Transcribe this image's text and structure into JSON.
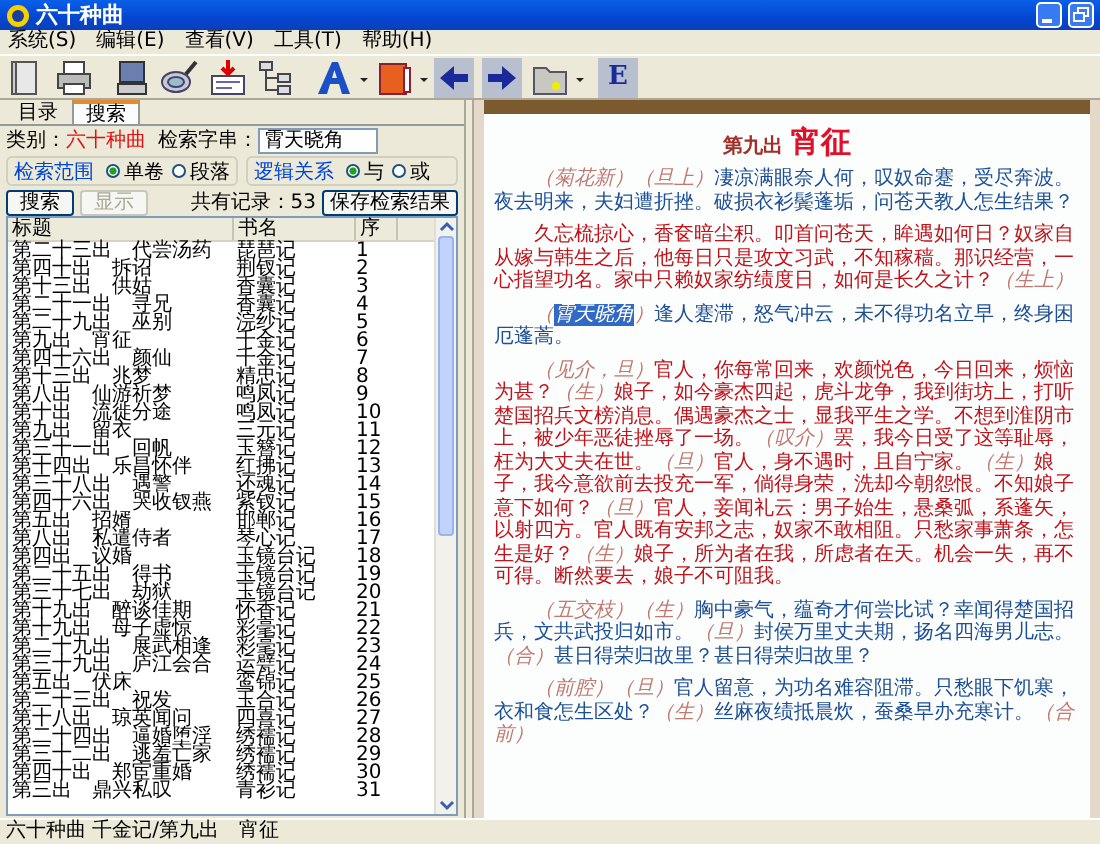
{
  "window": {
    "title": "六十种曲"
  },
  "menu": [
    "系统(S)",
    "编辑(E)",
    "查看(V)",
    "工具(T)",
    "帮助(H)"
  ],
  "toolbar": {
    "text_button": "E"
  },
  "tabs": [
    {
      "label": "目录",
      "selected": false
    },
    {
      "label": "搜索",
      "selected": true
    }
  ],
  "search": {
    "category_label": "类别：",
    "category_value": "六十种曲",
    "query_label": "检索字串：",
    "query": "霄天晓角",
    "groups": [
      {
        "label": "检索范围",
        "options": [
          {
            "label": "单卷",
            "selected": true
          },
          {
            "label": "段落",
            "selected": false
          }
        ]
      },
      {
        "label": "逻辑关系",
        "options": [
          {
            "label": "与",
            "selected": true
          },
          {
            "label": "或",
            "selected": false
          }
        ]
      }
    ],
    "buttons": [
      {
        "label": "搜索",
        "disabled": false
      },
      {
        "label": "显示",
        "disabled": true
      }
    ],
    "record_count": "共有记录：53",
    "save_button": "保存检索结果"
  },
  "table": {
    "columns": [
      "标题",
      "书名",
      "序"
    ],
    "rows": [
      {
        "title": "第二十三出　代尝汤药",
        "book": "琵琶记",
        "no": "1"
      },
      {
        "title": "第四十出　拆诏",
        "book": "荆钗记",
        "no": "2"
      },
      {
        "title": "第十三出　供姑",
        "book": "香囊记",
        "no": "3"
      },
      {
        "title": "第二十一出　寻兄",
        "book": "香囊记",
        "no": "4"
      },
      {
        "title": "第二十九出　巫别",
        "book": "浣纱记",
        "no": "5"
      },
      {
        "title": "第九出　宵征",
        "book": "千金记",
        "no": "6"
      },
      {
        "title": "第四十六出　颜仙",
        "book": "千金记",
        "no": "7"
      },
      {
        "title": "第十三出　兆梦",
        "book": "精忠记",
        "no": "8"
      },
      {
        "title": "第八出　仙游祈梦",
        "book": "鸣凤记",
        "no": "9"
      },
      {
        "title": "第十出　流徙分途",
        "book": "鸣凤记",
        "no": "10"
      },
      {
        "title": "第九出　留衣",
        "book": "三元记",
        "no": "11"
      },
      {
        "title": "第三十一出　回帆",
        "book": "玉簪记",
        "no": "12"
      },
      {
        "title": "第十四出　乐昌怀伴",
        "book": "红拂记",
        "no": "13"
      },
      {
        "title": "第三十八出　遇警",
        "book": "还魂记",
        "no": "14"
      },
      {
        "title": "第四十六出　哭收钗燕",
        "book": "紫钗记",
        "no": "15"
      },
      {
        "title": "第五出　招婿",
        "book": "邯郸记",
        "no": "16"
      },
      {
        "title": "第八出　私遣侍者",
        "book": "琴心记",
        "no": "17"
      },
      {
        "title": "第四出　议婚",
        "book": "玉镜台记",
        "no": "18"
      },
      {
        "title": "第二十五出　得书",
        "book": "玉镜台记",
        "no": "19"
      },
      {
        "title": "第三十七出　劫狱",
        "book": "玉镜台记",
        "no": "20"
      },
      {
        "title": "第十九出　醉谈佳期",
        "book": "怀香记",
        "no": "21"
      },
      {
        "title": "第十九出　母子虚惊",
        "book": "彩毫记",
        "no": "22"
      },
      {
        "title": "第二十九出　展武相逢",
        "book": "彩毫记",
        "no": "23"
      },
      {
        "title": "第三十九出　庐江会合",
        "book": "运甓记",
        "no": "24"
      },
      {
        "title": "第五出　伏床",
        "book": "鸾锦记",
        "no": "25"
      },
      {
        "title": "第二十三出　祝发",
        "book": "玉合记",
        "no": "26"
      },
      {
        "title": "第十八出　琼英闻问",
        "book": "四喜记",
        "no": "27"
      },
      {
        "title": "第二十四出　逼婚堕淫",
        "book": "绣襦记",
        "no": "28"
      },
      {
        "title": "第三十二出　逃羞亡家",
        "book": "绣襦记",
        "no": "29"
      },
      {
        "title": "第四十出　郑宦重婚",
        "book": "绣襦记",
        "no": "30"
      },
      {
        "title": "第三出　鼎兴私叹",
        "book": "青衫记",
        "no": "31"
      }
    ]
  },
  "reader": {
    "act": "第九出",
    "title": "宵征",
    "paragraphs": [
      {
        "kind": "verse",
        "segments": [
          {
            "kind": "tag",
            "text": "（菊花新）"
          },
          {
            "kind": "tag",
            "text": "（旦上）"
          },
          {
            "kind": "text",
            "text": "凄凉满眼奈人何，叹奴命蹇，受尽奔波。夜去明来，夫妇遭折挫。破损衣衫鬓蓬垢，问苍天教人怎生结果？"
          }
        ]
      },
      {
        "kind": "prose",
        "segments": [
          {
            "kind": "text",
            "text": "久忘梳掠心，香奁暗尘积。叩首问苍天，眸遇如何日？奴家自从嫁与韩生之后，他每日只是攻文习武，不知稼穑。那识经营，一心指望功名。家中只赖奴家纺绩度日，如何是长久之计？"
          },
          {
            "kind": "tag",
            "text": "（生上）"
          }
        ]
      },
      {
        "kind": "verse",
        "segments": [
          {
            "kind": "tag",
            "text": "（",
            "highlighted": false
          },
          {
            "kind": "tag",
            "text": "霄天晓角",
            "highlighted": true
          },
          {
            "kind": "tag",
            "text": "）",
            "highlighted": false
          },
          {
            "kind": "text",
            "text": "逢人蹇滞，怒气冲云，未不得功名立早，终身困厄蓬蒿。"
          }
        ]
      },
      {
        "kind": "prose",
        "segments": [
          {
            "kind": "tag",
            "text": "（见介，旦）"
          },
          {
            "kind": "text",
            "text": "官人，你每常回来，欢颜悦色，今日回来，烦恼为甚？"
          },
          {
            "kind": "tag",
            "text": "（生）"
          },
          {
            "kind": "text",
            "text": "娘子，如今豪杰四起，虎斗龙争，我到街坊上，打听楚国招兵文榜消息。偶遇豪杰之士，显我平生之学。不想到淮阴市上，被少年恶徒挫辱了一场。"
          },
          {
            "kind": "tag",
            "text": "（叹介）"
          },
          {
            "kind": "text",
            "text": "罢，我今日受了这等耻辱，枉为大丈夫在世。"
          },
          {
            "kind": "tag",
            "text": "（旦）"
          },
          {
            "kind": "text",
            "text": "官人，身不遇时，且自宁家。"
          },
          {
            "kind": "tag",
            "text": "（生）"
          },
          {
            "kind": "text",
            "text": "娘子，我今意欲前去投充一军，倘得身荣，洗却今朝怨恨。不知娘子意下如何？"
          },
          {
            "kind": "tag",
            "text": "（旦）"
          },
          {
            "kind": "text",
            "text": "官人，妾闻礼云：男子始生，悬桑弧，系蓬矢，以射四方。官人既有安邦之志，奴家不敢相阻。只愁家事萧条，怎生是好？"
          },
          {
            "kind": "tag",
            "text": "（生）"
          },
          {
            "kind": "text",
            "text": "娘子，所为者在我，所虑者在天。机会一失，再不可得。断然要去，娘子不可阻我。"
          }
        ]
      },
      {
        "kind": "verse",
        "segments": [
          {
            "kind": "tag",
            "text": "（五交枝）"
          },
          {
            "kind": "tag",
            "text": "（生）"
          },
          {
            "kind": "text",
            "text": "胸中豪气，蕴奇才何尝比试？幸闻得楚国招兵，文共武投归如市。"
          },
          {
            "kind": "tag",
            "text": "（旦）"
          },
          {
            "kind": "text",
            "text": "封侯万里丈夫期，扬名四海男儿志。"
          },
          {
            "kind": "tag",
            "text": "（合）"
          },
          {
            "kind": "text",
            "text": "甚日得荣归故里？甚日得荣归故里？"
          }
        ]
      },
      {
        "kind": "verse",
        "segments": [
          {
            "kind": "tag",
            "text": "（前腔）"
          },
          {
            "kind": "tag",
            "text": "（旦）"
          },
          {
            "kind": "text",
            "text": "官人留意，为功名难容阻滞。只愁眼下饥寒，衣和食怎生区处？"
          },
          {
            "kind": "tag",
            "text": "（生）"
          },
          {
            "kind": "text",
            "text": "丝麻夜绩抵晨炊，蚕桑早办充寒计。"
          },
          {
            "kind": "tag",
            "text": "（合前）"
          }
        ]
      }
    ]
  },
  "status_bar": [
    "六十种曲 千金记/第九出",
    "宵征"
  ]
}
